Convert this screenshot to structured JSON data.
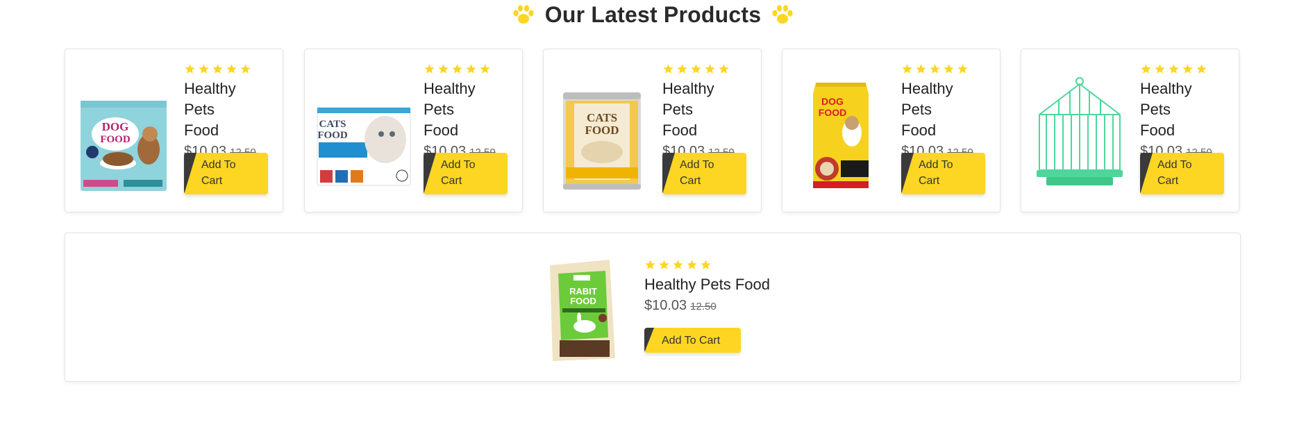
{
  "section": {
    "title": "Our Latest Products",
    "icon": "paw-icon",
    "accent_color": "#fcd622"
  },
  "products": [
    {
      "image_icon": "dog-food-box-image",
      "name": "Healthy Pets Food",
      "price": "$10.03",
      "old_price": "12.50",
      "cart_label": "Add To Cart",
      "rating": 5,
      "box_text_1": "DOG",
      "box_text_2": "FOOD"
    },
    {
      "image_icon": "cats-food-pack-image",
      "name": "Healthy Pets Food",
      "price": "$10.03",
      "old_price": "12.50",
      "cart_label": "Add To Cart",
      "rating": 5,
      "box_text_1": "CATS",
      "box_text_2": "FOOD"
    },
    {
      "image_icon": "cats-food-can-image",
      "name": "Healthy Pets Food",
      "price": "$10.03",
      "old_price": "12.50",
      "cart_label": "Add To Cart",
      "rating": 5,
      "box_text_1": "CATS",
      "box_text_2": "FOOD"
    },
    {
      "image_icon": "dog-food-bag-image",
      "name": "Healthy Pets Food",
      "price": "$10.03",
      "old_price": "12.50",
      "cart_label": "Add To Cart",
      "rating": 5,
      "box_text_1": "DOG",
      "box_text_2": "FOOD"
    },
    {
      "image_icon": "bird-cage-image",
      "name": "Healthy Pets Food",
      "price": "$10.03",
      "old_price": "12.50",
      "cart_label": "Add To Cart",
      "rating": 5
    },
    {
      "image_icon": "rabbit-food-bag-image",
      "name": "Healthy Pets Food",
      "price": "$10.03",
      "old_price": "12.50",
      "cart_label": "Add To Cart",
      "rating": 5,
      "box_text_1": "RABIT",
      "box_text_2": "FOOD"
    }
  ],
  "colors": {
    "star": "#fcd622",
    "button": "#fcd622",
    "button_corner": "#3a3a3a",
    "card_border": "#e3e3e3"
  }
}
